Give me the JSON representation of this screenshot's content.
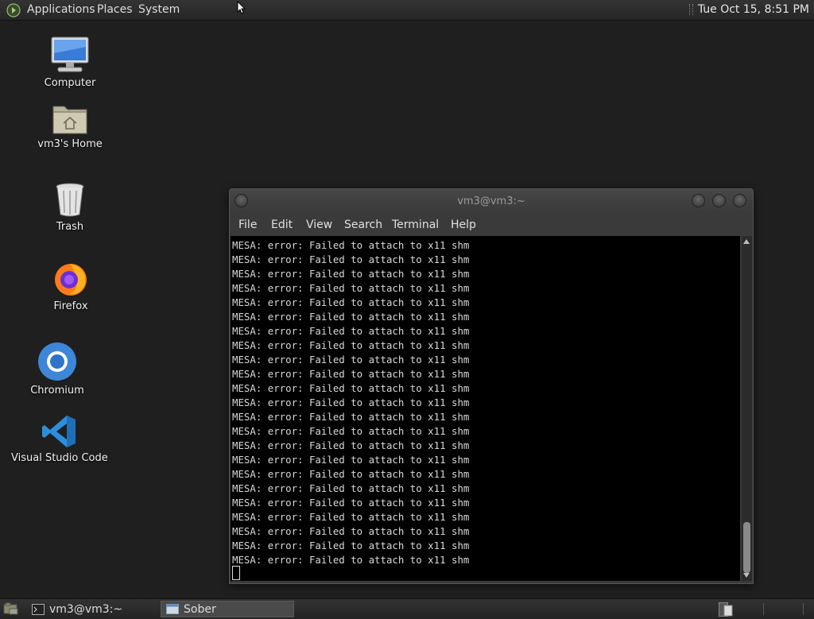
{
  "top_panel": {
    "menus": [
      "Applications",
      "Places",
      "System"
    ],
    "clock": "Tue Oct 15,  8:51 PM"
  },
  "desktop": {
    "icons": [
      {
        "label": "Computer",
        "icon": "computer-icon"
      },
      {
        "label": "vm3's Home",
        "icon": "home-folder-icon"
      },
      {
        "label": "Trash",
        "icon": "trash-icon"
      },
      {
        "label": "Firefox",
        "icon": "firefox-icon"
      },
      {
        "label": "Chromium",
        "icon": "chromium-icon"
      },
      {
        "label": "Visual Studio Code",
        "icon": "vscode-icon"
      }
    ]
  },
  "terminal": {
    "title": "vm3@vm3:~",
    "menu": [
      "File",
      "Edit",
      "View",
      "Search",
      "Terminal",
      "Help"
    ],
    "lines": [
      "MESA: error: Failed to attach to x11 shm",
      "MESA: error: Failed to attach to x11 shm",
      "MESA: error: Failed to attach to x11 shm",
      "MESA: error: Failed to attach to x11 shm",
      "MESA: error: Failed to attach to x11 shm",
      "MESA: error: Failed to attach to x11 shm",
      "MESA: error: Failed to attach to x11 shm",
      "MESA: error: Failed to attach to x11 shm",
      "MESA: error: Failed to attach to x11 shm",
      "MESA: error: Failed to attach to x11 shm",
      "MESA: error: Failed to attach to x11 shm",
      "MESA: error: Failed to attach to x11 shm",
      "MESA: error: Failed to attach to x11 shm",
      "MESA: error: Failed to attach to x11 shm",
      "MESA: error: Failed to attach to x11 shm",
      "MESA: error: Failed to attach to x11 shm",
      "MESA: error: Failed to attach to x11 shm",
      "MESA: error: Failed to attach to x11 shm",
      "MESA: error: Failed to attach to x11 shm",
      "MESA: error: Failed to attach to x11 shm",
      "MESA: error: Failed to attach to x11 shm",
      "MESA: error: Failed to attach to x11 shm",
      "MESA: error: Failed to attach to x11 shm"
    ]
  },
  "taskbar": {
    "tasks": [
      {
        "label": "vm3@vm3:~",
        "icon": "terminal-icon",
        "active": false
      },
      {
        "label": "Sober",
        "icon": "window-icon",
        "active": true
      }
    ]
  },
  "colors": {
    "desktop_bg": "#1f1f1f",
    "panel_bg": "#2b2b2b",
    "terminal_bg": "#000000"
  }
}
